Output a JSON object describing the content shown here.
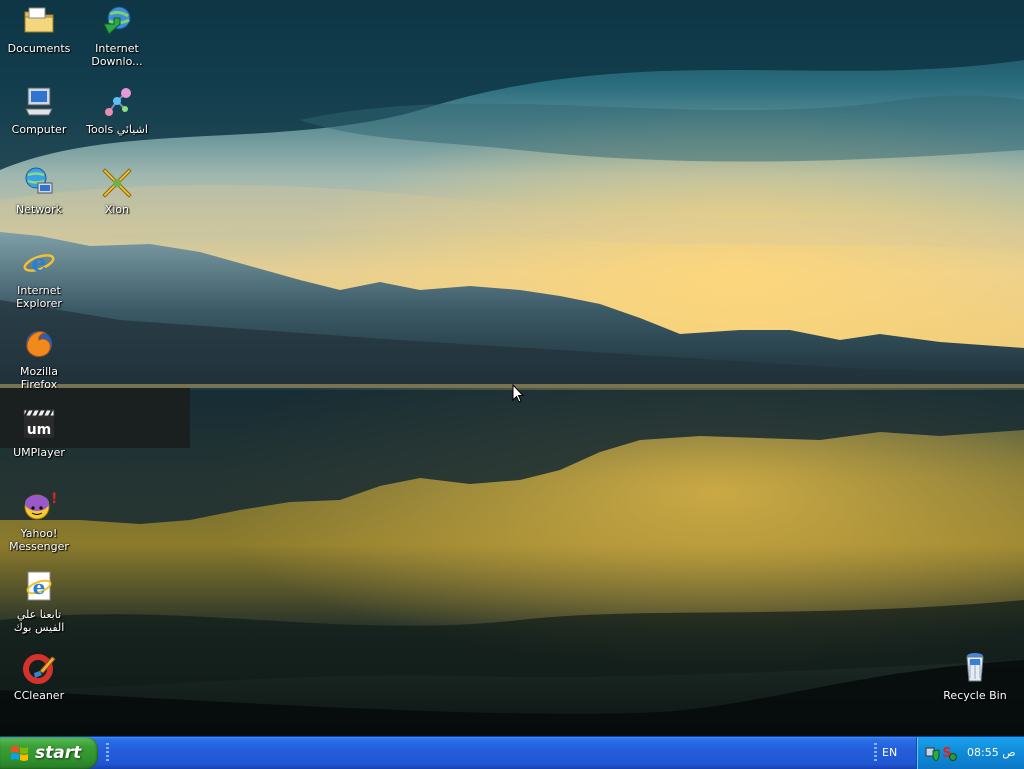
{
  "desktop": {
    "icons": [
      {
        "name": "documents",
        "label": "Documents",
        "icon": "folder-icon"
      },
      {
        "name": "internet-download-manager",
        "label": "Internet\nDownlo...",
        "icon": "download-globe-icon"
      },
      {
        "name": "computer",
        "label": "Computer",
        "icon": "computer-icon"
      },
      {
        "name": "tools",
        "label": "Tools اشيائي",
        "icon": "molecule-icon"
      },
      {
        "name": "network",
        "label": "Network",
        "icon": "network-globe-icon"
      },
      {
        "name": "xion",
        "label": "Xion",
        "icon": "xion-icon"
      },
      {
        "name": "internet-explorer",
        "label": "Internet\nExplorer",
        "icon": "internet-explorer-icon"
      },
      {
        "name": "mozilla-firefox",
        "label": "Mozilla Firefox",
        "icon": "firefox-icon"
      },
      {
        "name": "umplayer",
        "label": "UMPlayer",
        "icon": "umplayer-icon"
      },
      {
        "name": "yahoo-messenger",
        "label": "Yahoo!\nMessenger",
        "icon": "yahoo-messenger-icon"
      },
      {
        "name": "facebook-shortcut",
        "label": "تابعنا علي\nالفيس بوك",
        "icon": "internet-explorer-page-icon"
      },
      {
        "name": "ccleaner",
        "label": "CCleaner",
        "icon": "ccleaner-icon"
      },
      {
        "name": "recycle-bin",
        "label": "Recycle Bin",
        "icon": "recycle-bin-icon"
      }
    ]
  },
  "taskbar": {
    "start_label": "start",
    "language": "EN",
    "clock": "08:55 ص",
    "tray_icons": [
      "network-shield-icon",
      "security-s-icon",
      "antivirus-icon"
    ]
  },
  "colors": {
    "taskbar_blue": "#245edb",
    "start_green": "#3b9e37",
    "tray_blue": "#0f8ad9"
  }
}
